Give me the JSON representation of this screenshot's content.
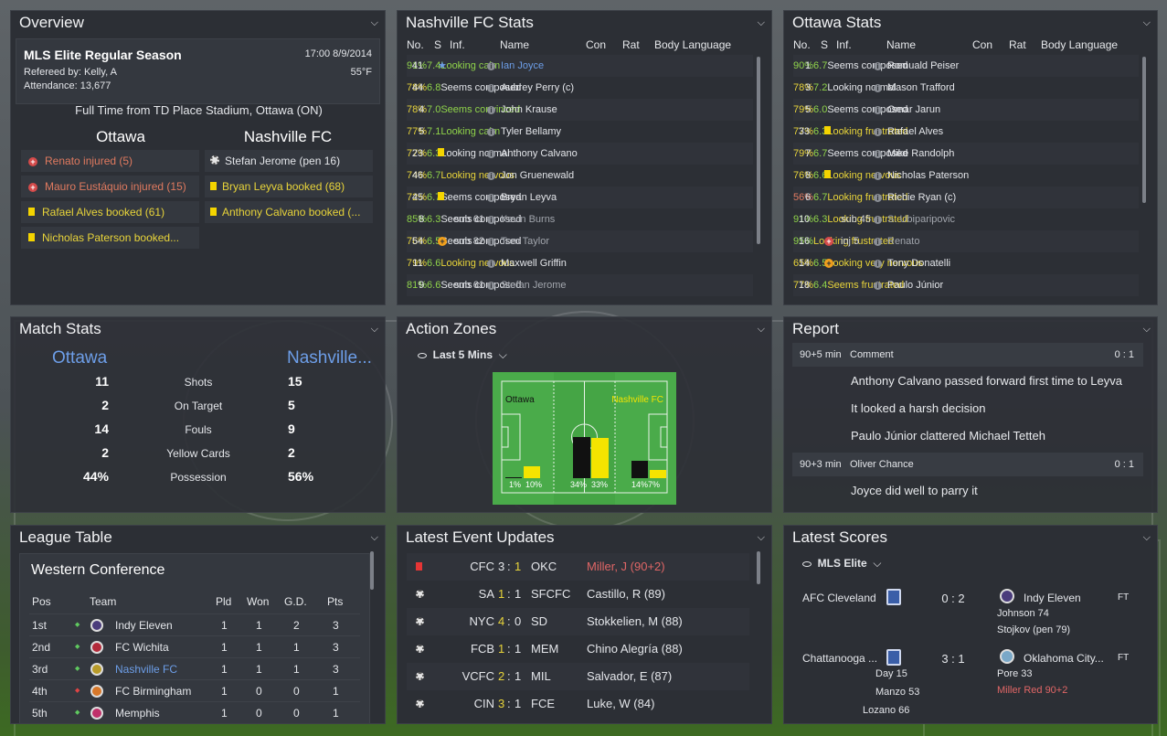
{
  "overview": {
    "title": "Overview",
    "competition": "MLS Elite Regular Season",
    "datetime": "17:00 8/9/2014",
    "referee": "Refereed by: Kelly, A",
    "temperature": "55°F",
    "attendance": "Attendance: 13,677",
    "result": "Full Time from TD Place Stadium, Ottawa (ON)",
    "home": "Ottawa",
    "away": "Nashville FC",
    "home_events": [
      "Renato injured (5)",
      "Mauro Eustáquio injured (15)",
      "Rafael Alves booked (61)",
      "Nicholas Paterson booked..."
    ],
    "away_events": [
      "Stefan Jerome (pen 16)",
      "Bryan Leyva booked (68)",
      "Anthony Calvano booked (..."
    ]
  },
  "nash": {
    "title": "Nashville FC Stats",
    "headers": [
      "No.",
      "S",
      "Inf.",
      "Name",
      "Con",
      "Rat",
      "Body Language"
    ],
    "rows": [
      {
        "no": "41",
        "inf": "",
        "name": "Ian Joyce",
        "con": "91%",
        "rat": "7.4",
        "bl": "Looking calm"
      },
      {
        "no": "44",
        "inf": "",
        "name": "Aubrey Perry (c)",
        "con": "78%",
        "rat": "6.8",
        "bl": "Seems composed"
      },
      {
        "no": "4",
        "inf": "",
        "name": "John Krause",
        "con": "78%",
        "rat": "7.0",
        "bl": "Seems convinced"
      },
      {
        "no": "5",
        "inf": "",
        "name": "Tyler Bellamy",
        "con": "77%",
        "rat": "7.1",
        "bl": "Looking calm"
      },
      {
        "no": "23",
        "inf": "",
        "name": "Anthony Calvano",
        "con": "77%",
        "rat": "6.3",
        "bl": "Looking normal"
      },
      {
        "no": "46",
        "inf": "",
        "name": "Jon Gruenewald",
        "con": "74%",
        "rat": "6.7",
        "bl": "Looking nervous"
      },
      {
        "no": "45",
        "inf": "",
        "name": "Bryan Leyva",
        "con": "72%",
        "rat": "6.7",
        "bl": "Seems composed"
      },
      {
        "no": "8",
        "inf": "sub 61",
        "name": "Kevin Burns",
        "con": "85%",
        "rat": "6.3",
        "bl": "Seems composed"
      },
      {
        "no": "54",
        "inf": "sub 82",
        "name": "Tom Taylor",
        "con": "76%",
        "rat": "6.5",
        "bl": "Seems composed"
      },
      {
        "no": "11",
        "inf": "",
        "name": "Maxwell Griffin",
        "con": "79%",
        "rat": "6.6",
        "bl": "Looking nervous"
      },
      {
        "no": "9",
        "inf": "sub 61",
        "name": "Stefan Jerome",
        "con": "81%",
        "rat": "6.6",
        "bl": "Seems composed"
      }
    ]
  },
  "otta": {
    "title": "Ottawa Stats",
    "headers": [
      "No.",
      "S",
      "Inf.",
      "Name",
      "Con",
      "Rat",
      "Body Language"
    ],
    "rows": [
      {
        "no": "1",
        "inf": "",
        "name": "Romuald Peiser",
        "con": "90%",
        "rat": "6.7",
        "bl": "Seems composed"
      },
      {
        "no": "3",
        "inf": "",
        "name": "Mason Trafford",
        "con": "78%",
        "rat": "7.2",
        "bl": "Looking normal"
      },
      {
        "no": "5",
        "inf": "",
        "name": "Omar Jarun",
        "con": "79%",
        "rat": "6.0",
        "bl": "Seems composed"
      },
      {
        "no": "33",
        "inf": "",
        "name": "Rafael Alves",
        "con": "77%",
        "rat": "6.3",
        "bl": "Looking frustrated"
      },
      {
        "no": "7",
        "inf": "",
        "name": "Mike Randolph",
        "con": "79%",
        "rat": "6.7",
        "bl": "Seems composed"
      },
      {
        "no": "8",
        "inf": "",
        "name": "Nicholas Paterson",
        "con": "76%",
        "rat": "6.6",
        "bl": "Looking nervous"
      },
      {
        "no": "6",
        "inf": "",
        "name": "Richie Ryan (c)",
        "con": "56%",
        "rat": "6.7",
        "bl": "Looking frustrated"
      },
      {
        "no": "10",
        "inf": "sub 45",
        "name": "S. Ubiparipovic",
        "con": "91%",
        "rat": "6.3",
        "bl": "Looking frustrated"
      },
      {
        "no": "16",
        "inf": "inj 5",
        "name": "Renato",
        "con": "95%",
        "rat": "",
        "bl": "Looking frustrated"
      },
      {
        "no": "14",
        "inf": "",
        "name": "Tony Donatelli",
        "con": "65%",
        "rat": "6.5",
        "bl": "Looking very nervous"
      },
      {
        "no": "18",
        "inf": "",
        "name": "Paulo Júnior",
        "con": "77%",
        "rat": "6.4",
        "bl": "Seems frustrated"
      }
    ]
  },
  "match_stats": {
    "title": "Match Stats",
    "home": "Ottawa",
    "away": "Nashville...",
    "rows": [
      {
        "label": "Shots",
        "home": "11",
        "away": "15"
      },
      {
        "label": "On Target",
        "home": "2",
        "away": "5"
      },
      {
        "label": "Fouls",
        "home": "14",
        "away": "9"
      },
      {
        "label": "Yellow Cards",
        "home": "2",
        "away": "2"
      },
      {
        "label": "Possession",
        "home": "44%",
        "away": "56%"
      }
    ]
  },
  "action": {
    "title": "Action Zones",
    "filter": "Last 5 Mins",
    "home": "Ottawa",
    "away": "Nashville FC",
    "zones": [
      {
        "label": "1%",
        "home_pct": 1,
        "away_pct": 10,
        "label2": "10%"
      },
      {
        "label": "34%",
        "home_pct": 34,
        "away_pct": 33,
        "label2": "33%"
      },
      {
        "label": "14%",
        "home_pct": 14,
        "away_pct": 7,
        "label2": "7%"
      }
    ]
  },
  "report": {
    "title": "Report",
    "entries": [
      {
        "type": "header",
        "time": "90+5 min",
        "who": "Comment",
        "score": "0 : 1"
      },
      {
        "type": "text",
        "text": "Anthony Calvano passed forward first time to Leyva"
      },
      {
        "type": "text",
        "text": "It looked a harsh decision"
      },
      {
        "type": "text",
        "text": "Paulo Júnior clattered Michael Tetteh"
      },
      {
        "type": "header",
        "time": "90+3 min",
        "who": "Oliver Chance",
        "score": "0 : 1"
      },
      {
        "type": "text",
        "text": "Joyce did well to parry it"
      }
    ]
  },
  "league": {
    "title": "League Table",
    "conference": "Western Conference",
    "headers": [
      "Pos",
      "Team",
      "Pld",
      "Won",
      "G.D.",
      "Pts"
    ],
    "rows": [
      {
        "pos": "1st",
        "team": "Indy Eleven",
        "pld": "1",
        "won": "1",
        "gd": "2",
        "pts": "3",
        "move": "up"
      },
      {
        "pos": "2nd",
        "team": "FC Wichita",
        "pld": "1",
        "won": "1",
        "gd": "1",
        "pts": "3",
        "move": "up"
      },
      {
        "pos": "3rd",
        "team": "Nashville FC",
        "pld": "1",
        "won": "1",
        "gd": "1",
        "pts": "3",
        "move": "up"
      },
      {
        "pos": "4th",
        "team": "FC Birmingham",
        "pld": "1",
        "won": "0",
        "gd": "0",
        "pts": "1",
        "move": "down"
      },
      {
        "pos": "5th",
        "team": "Memphis",
        "pld": "1",
        "won": "0",
        "gd": "0",
        "pts": "1",
        "move": "up"
      }
    ]
  },
  "events": {
    "title": "Latest Event Updates",
    "rows": [
      {
        "icon": "red",
        "home": "CFC",
        "hs": "3",
        "as": "1",
        "away": "OKC",
        "desc": "Miller, J (90+2)",
        "hl": "a"
      },
      {
        "icon": "ball",
        "home": "SA",
        "hs": "1",
        "as": "1",
        "away": "SFCFC",
        "desc": "Castillo, R (89)",
        "hl": "h"
      },
      {
        "icon": "ball",
        "home": "NYC",
        "hs": "4",
        "as": "0",
        "away": "SD",
        "desc": "Stokkelien, M (88)",
        "hl": "h"
      },
      {
        "icon": "ball",
        "home": "FCB",
        "hs": "1",
        "as": "1",
        "away": "MEM",
        "desc": "Chino Alegría (88)",
        "hl": "h"
      },
      {
        "icon": "ball",
        "home": "VCFC",
        "hs": "2",
        "as": "1",
        "away": "MIL",
        "desc": "Salvador, E (87)",
        "hl": "h"
      },
      {
        "icon": "ball",
        "home": "CIN",
        "hs": "3",
        "as": "1",
        "away": "FCE",
        "desc": "Luke, W (84)",
        "hl": "h"
      }
    ]
  },
  "scores": {
    "title": "Latest Scores",
    "filter": "MLS Elite",
    "games": [
      {
        "home": "AFC Cleveland",
        "score": "0 : 2",
        "away": "Indy Eleven",
        "status": "FT",
        "home_scorers": [],
        "away_scorers": [
          "Johnson 74",
          "Stojkov (pen 79)"
        ]
      },
      {
        "home": "Chattanooga ...",
        "score": "3 : 1",
        "away": "Oklahoma City...",
        "status": "FT",
        "home_scorers": [
          "Day 15",
          "Manzo 53",
          "Lozano 66"
        ],
        "away_scorers": [
          "Pore 33",
          "Miller Red 90+2"
        ]
      }
    ]
  }
}
